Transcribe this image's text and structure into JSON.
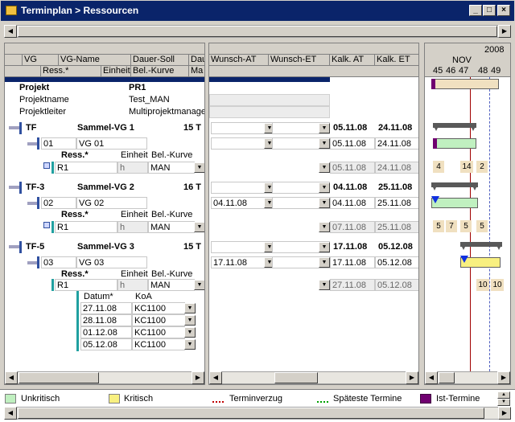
{
  "window": {
    "title": "Terminplan > Ressourcen",
    "min": "_",
    "max": "□",
    "close": "×"
  },
  "colors": {
    "unkritisch": "#c0f0c0",
    "kritisch": "#f8f080",
    "today_line": "#a00000",
    "titlebar": "#0a246a"
  },
  "left_headers": {
    "row1": [
      "VG",
      "VG-Name",
      "Dauer-Soll",
      "Dau"
    ],
    "row2": [
      "Ress.*",
      "Einheit",
      "Bel.-Kurve",
      "Ma"
    ]
  },
  "mid_headers": {
    "row1": [
      "Wunsch-AT",
      "Wunsch-ET",
      "Kalk. AT",
      "Kalk. ET"
    ]
  },
  "project": {
    "header_label": "Projekt",
    "header_value": "PR1",
    "rows": [
      {
        "label": "Projektname",
        "value": "Test_MAN"
      },
      {
        "label": "Projektleiter",
        "value": "Multiprojektmanager"
      }
    ]
  },
  "groups": [
    {
      "id": "TF",
      "name": "Sammel-VG 1",
      "dur": "15 T",
      "kalk_at": "05.11.08",
      "kalk_et": "24.11.08",
      "vg": {
        "id": "01",
        "name": "VG 01",
        "wunsch_at": "",
        "kalk_at": "05.11.08",
        "kalk_et": "24.11.08"
      },
      "res_header": {
        "ress": "Ress.*",
        "einheit": "Einheit",
        "kurve": "Bel.-Kurve"
      },
      "res": {
        "id": "R1",
        "einheit": "h",
        "kurve": "MAN",
        "kalk_at": "05.11.08",
        "kalk_et": "24.11.08"
      },
      "week_labels": [
        "4",
        "14",
        "2"
      ]
    },
    {
      "id": "TF-3",
      "name": "Sammel-VG 2",
      "dur": "16 T",
      "kalk_at": "04.11.08",
      "kalk_et": "25.11.08",
      "vg": {
        "id": "02",
        "name": "VG 02",
        "wunsch_at": "04.11.08",
        "kalk_at": "04.11.08",
        "kalk_et": "25.11.08"
      },
      "res_header": {
        "ress": "Ress.*",
        "einheit": "Einheit",
        "kurve": "Bel.-Kurve"
      },
      "res": {
        "id": "R1",
        "einheit": "h",
        "kurve": "MAN",
        "kalk_at": "07.11.08",
        "kalk_et": "25.11.08"
      },
      "week_labels": [
        "5",
        "7",
        "5",
        "5"
      ]
    },
    {
      "id": "TF-5",
      "name": "Sammel-VG 3",
      "dur": "15 T",
      "kalk_at": "17.11.08",
      "kalk_et": "05.12.08",
      "vg": {
        "id": "03",
        "name": "VG 03",
        "wunsch_at": "17.11.08",
        "kalk_at": "17.11.08",
        "kalk_et": "05.12.08"
      },
      "res_header": {
        "ress": "Ress.*",
        "einheit": "Einheit",
        "kurve": "Bel.-Kurve"
      },
      "res": {
        "id": "R1",
        "einheit": "h",
        "kurve": "MAN",
        "kalk_at": "27.11.08",
        "kalk_et": "05.12.08"
      },
      "week_labels": [
        "10",
        "10"
      ]
    }
  ],
  "koa_table": {
    "headers": [
      "Datum*",
      "KoA"
    ],
    "rows": [
      [
        "27.11.08",
        "KC1100"
      ],
      [
        "28.11.08",
        "KC1100"
      ],
      [
        "01.12.08",
        "KC1100"
      ],
      [
        "05.12.08",
        "KC1100"
      ]
    ]
  },
  "gantt": {
    "year": "2008",
    "month": "NOV",
    "weeks": [
      "45",
      "46",
      "47",
      "48",
      "49"
    ]
  },
  "legend": [
    {
      "label": "Unkritisch"
    },
    {
      "label": "Kritisch"
    },
    {
      "label": "Terminverzug"
    },
    {
      "label": "Späteste Termine"
    },
    {
      "label": "Ist-Termine"
    }
  ]
}
